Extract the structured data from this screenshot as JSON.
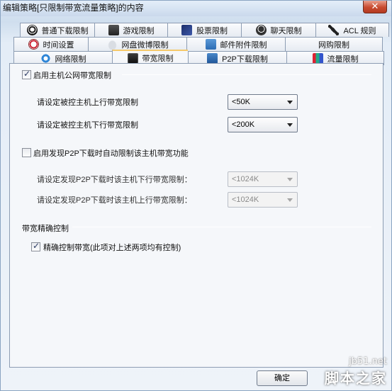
{
  "window": {
    "title": "编辑策略[只限制带宽流量策略]的内容",
    "close_glyph": "✕"
  },
  "tabs": {
    "row1": [
      {
        "label": "普通下载限制",
        "icon": "download-icon"
      },
      {
        "label": "游戏限制",
        "icon": "game-icon"
      },
      {
        "label": "股票限制",
        "icon": "stock-icon"
      },
      {
        "label": "聊天限制",
        "icon": "chat-icon"
      },
      {
        "label": "ACL 规则",
        "icon": "acl-icon"
      }
    ],
    "row2": [
      {
        "label": "时间设置",
        "icon": "clock-icon"
      },
      {
        "label": "网盘微博限制",
        "icon": "cloud-icon"
      },
      {
        "label": "邮件附件限制",
        "icon": "mail-icon"
      },
      {
        "label": "网购限制",
        "icon": ""
      }
    ],
    "row3": [
      {
        "label": "网络限制",
        "icon": "ie-icon"
      },
      {
        "label": "带宽限制",
        "icon": "bandwidth-icon",
        "active": true
      },
      {
        "label": "P2P下载限制",
        "icon": "p2p-icon"
      },
      {
        "label": "流量限制",
        "icon": "traffic-icon"
      }
    ]
  },
  "bandwidth": {
    "enable_label": "启用主机公网带宽限制",
    "enable_checked": true,
    "upload_label": "请设定被控主机上行带宽限制",
    "upload_value": "<50K",
    "download_label": "请设定被控主机下行带宽限制",
    "download_value": "<200K"
  },
  "p2p": {
    "enable_label": "启用发现P2P下载时自动限制该主机带宽功能",
    "enable_checked": false,
    "download_label": "请设定发现P2P下载时该主机下行带宽限制：",
    "download_value": "<1024K",
    "upload_label": "请设定发现P2P下载时该主机上行带宽限制：",
    "upload_value": "<1024K"
  },
  "precise": {
    "section_label": "带宽精确控制",
    "checkbox_label": "精确控制带宽(此项对上述两项均有控制)",
    "checked": true
  },
  "footer": {
    "ok_label": "确定"
  },
  "watermark": {
    "url": "jb51.net",
    "name": "脚本之家"
  }
}
